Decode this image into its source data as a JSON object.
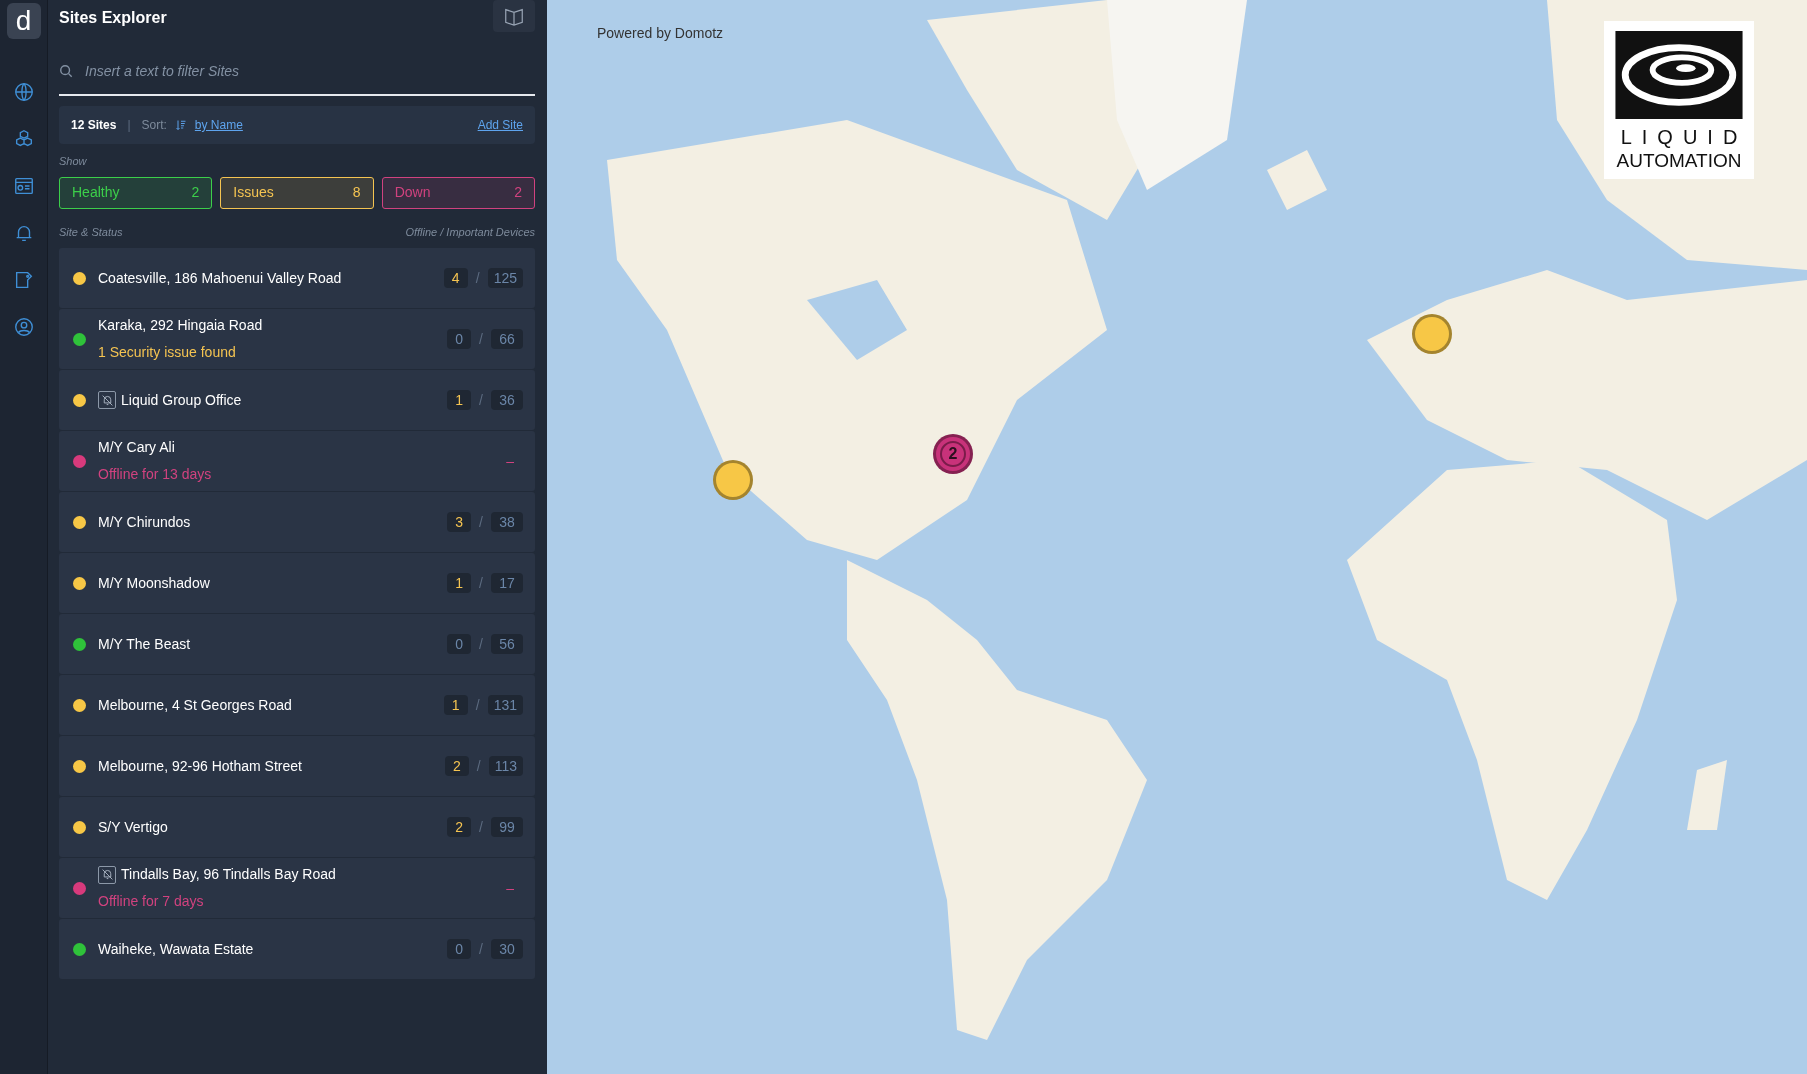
{
  "rail": {
    "logo": "d"
  },
  "sidebar": {
    "title": "Sites Explorer",
    "search": {
      "placeholder": "Insert a text to filter Sites"
    },
    "summary": {
      "count": "12 Sites",
      "separator": "|",
      "sort_label": "Sort:",
      "sort_value": "by Name",
      "add": "Add Site"
    },
    "show_label": "Show",
    "filters": [
      {
        "color": "#3ccf4a",
        "label": "Healthy",
        "count": "2"
      },
      {
        "color": "#f5c451",
        "label": "Issues",
        "count": "8"
      },
      {
        "color": "#d1427f",
        "label": "Down",
        "count": "2"
      }
    ],
    "columns": [
      "Site & Status",
      "Offline / Important Devices"
    ],
    "sites": [
      {
        "color": "#f7c746",
        "name": "Coatesville, 186 Mahoenui Valley Road",
        "muted": false,
        "offline": "4",
        "offline_alert": true,
        "separator": "/",
        "important": "125"
      },
      {
        "color": "#2fc23a",
        "name": "Karaka, 292 Hingaia Road",
        "muted": false,
        "note": {
          "text": "1 Security issue found",
          "color": "#f5c451"
        },
        "offline": "0",
        "offline_alert": false,
        "separator": "/",
        "important": "66"
      },
      {
        "color": "#f7c746",
        "name": "Liquid Group Office",
        "muted": true,
        "offline": "1",
        "offline_alert": true,
        "separator": "/",
        "important": "36"
      },
      {
        "color": "#d83a7c",
        "name": "M/Y Cary Ali",
        "muted": false,
        "note": {
          "text": "Offline for 13 days",
          "color": "#d1427f"
        },
        "dash": "–"
      },
      {
        "color": "#f7c746",
        "name": "M/Y Chirundos",
        "muted": false,
        "offline": "3",
        "offline_alert": true,
        "separator": "/",
        "important": "38"
      },
      {
        "color": "#f7c746",
        "name": "M/Y Moonshadow",
        "muted": false,
        "offline": "1",
        "offline_alert": true,
        "separator": "/",
        "important": "17"
      },
      {
        "color": "#2fc23a",
        "name": "M/Y The Beast",
        "muted": false,
        "offline": "0",
        "offline_alert": false,
        "separator": "/",
        "important": "56"
      },
      {
        "color": "#f7c746",
        "name": "Melbourne, 4 St Georges Road",
        "muted": false,
        "offline": "1",
        "offline_alert": true,
        "separator": "/",
        "important": "131"
      },
      {
        "color": "#f7c746",
        "name": "Melbourne, 92-96 Hotham Street",
        "muted": false,
        "offline": "2",
        "offline_alert": true,
        "separator": "/",
        "important": "113"
      },
      {
        "color": "#f7c746",
        "name": "S/Y Vertigo",
        "muted": false,
        "offline": "2",
        "offline_alert": true,
        "separator": "/",
        "important": "99"
      },
      {
        "color": "#d83a7c",
        "name": "Tindalls Bay, 96 Tindalls Bay Road",
        "muted": true,
        "note": {
          "text": "Offline for 7 days",
          "color": "#d1427f"
        },
        "dash": "–"
      },
      {
        "color": "#2fc23a",
        "name": "Waiheke, Wawata Estate",
        "muted": false,
        "offline": "0",
        "offline_alert": false,
        "separator": "/",
        "important": "30"
      }
    ]
  },
  "map": {
    "powered_by": "Powered by Domotz",
    "logo": {
      "line1": "LIQUID",
      "line2": "AUTOMATION"
    },
    "markers": [
      {
        "kind": "single",
        "color": "#f7c746"
      },
      {
        "kind": "cluster",
        "color": "#c8327a",
        "count": "2"
      },
      {
        "kind": "single",
        "color": "#f7c746"
      }
    ]
  }
}
